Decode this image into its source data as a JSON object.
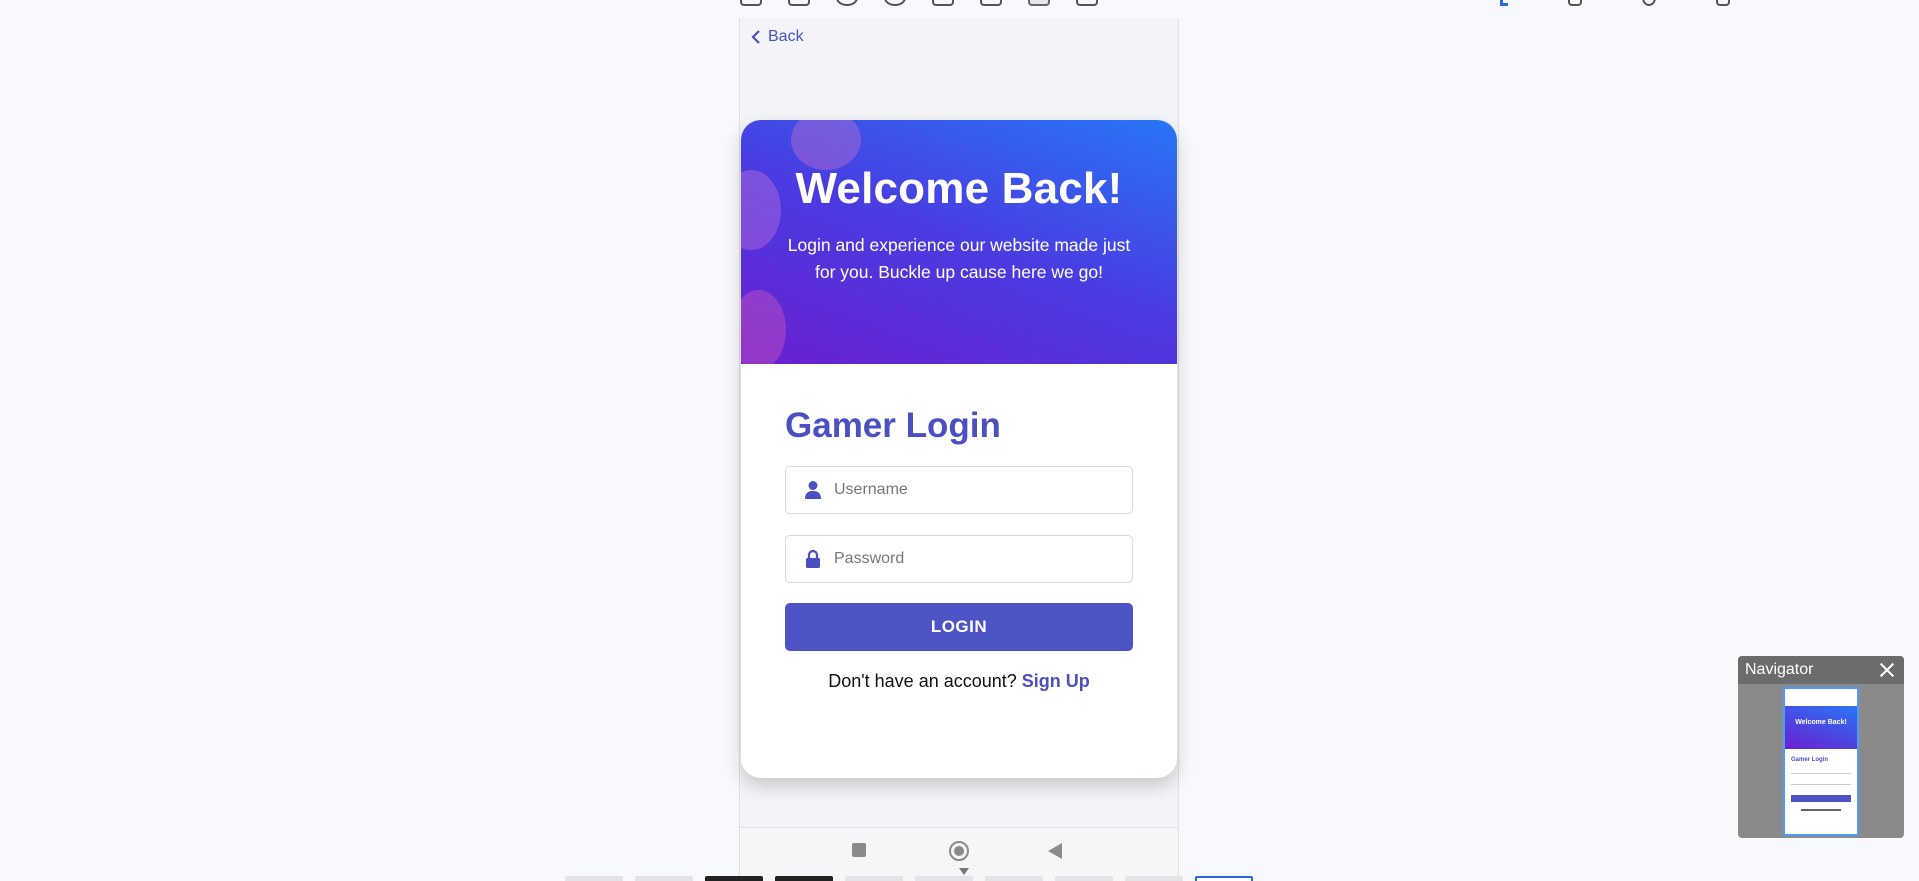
{
  "device": {
    "back_label": "Back"
  },
  "hero": {
    "title": "Welcome Back!",
    "subtitle": "Login and experience our website made just for you. Buckle up cause here we go!"
  },
  "form": {
    "title": "Gamer Login",
    "username_placeholder": "Username",
    "password_placeholder": "Password",
    "login_label": "LOGIN",
    "signup_prompt": "Don't have an account?",
    "signup_link": "Sign Up"
  },
  "navigator": {
    "title": "Navigator",
    "preview_title": "Welcome Back!",
    "preview_form_title": "Gamer Login"
  },
  "colors": {
    "accent": "#4a50c0",
    "button": "#4d52c4",
    "hero_gradient_start": "#2876f6",
    "hero_gradient_end": "#6a1fd0"
  }
}
